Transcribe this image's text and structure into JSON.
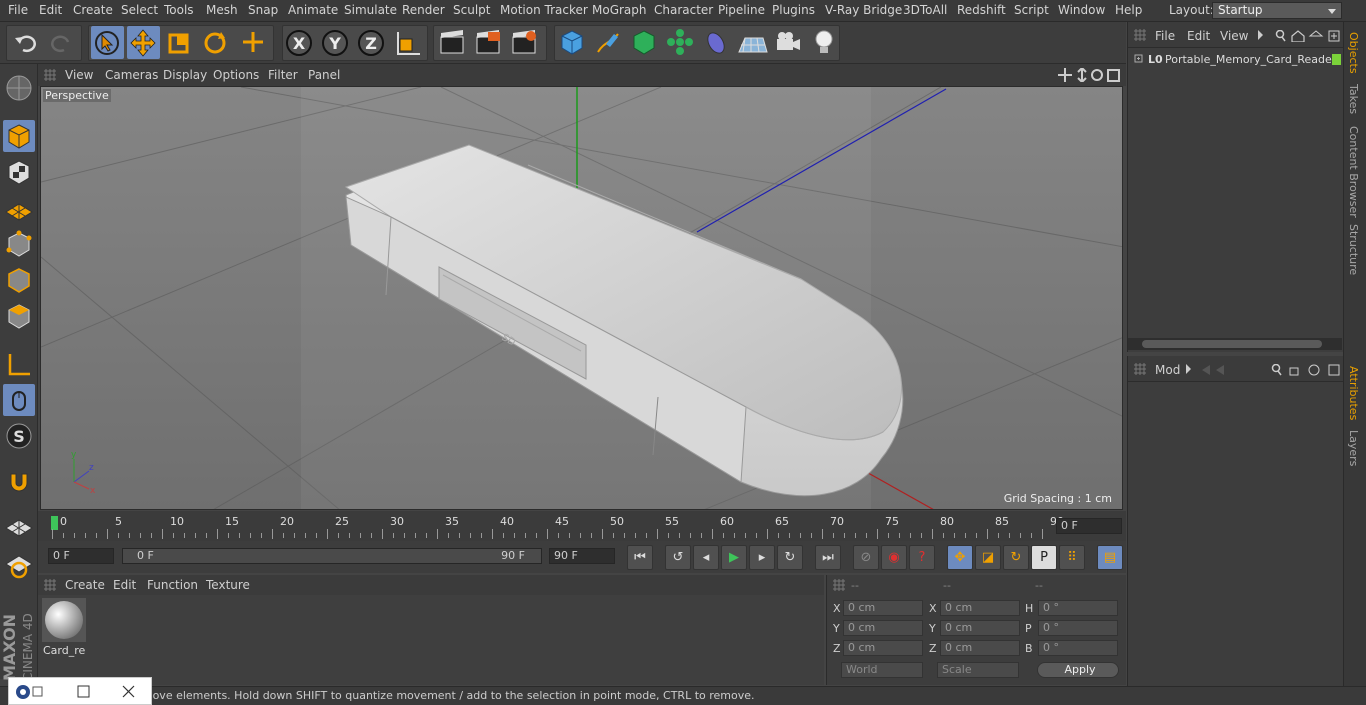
{
  "menubar": {
    "items": [
      "File",
      "Edit",
      "Create",
      "Select",
      "Tools",
      "Mesh",
      "Snap",
      "Animate",
      "Simulate",
      "Render",
      "Sculpt",
      "Motion Tracker",
      "MoGraph",
      "Character",
      "Pipeline",
      "Plugins",
      "V-Ray Bridge",
      "3DToAll",
      "Redshift",
      "Script",
      "Window",
      "Help"
    ],
    "layout_label": "Layout:",
    "layout_value": "Startup"
  },
  "viewport": {
    "menu": [
      "View",
      "Cameras",
      "Display",
      "Options",
      "Filter",
      "Panel"
    ],
    "camera_label": "Perspective",
    "grid_spacing": "Grid Spacing : 1 cm",
    "axis_x": "x",
    "axis_y": "y",
    "axis_z": "z"
  },
  "timeline": {
    "ticks": [
      "0",
      "5",
      "10",
      "15",
      "20",
      "25",
      "30",
      "35",
      "40",
      "45",
      "50",
      "55",
      "60",
      "65",
      "70",
      "75",
      "80",
      "85",
      "90"
    ],
    "current_frame": "0 F"
  },
  "transport": {
    "start_field": "0 F",
    "range_start": "0 F",
    "range_end": "90 F",
    "end_field": "90 F"
  },
  "materials": {
    "menu": [
      "Create",
      "Edit",
      "Function",
      "Texture"
    ],
    "items": [
      {
        "name": "Card_re"
      }
    ]
  },
  "coords": {
    "headers": [
      "--",
      "--",
      "--"
    ],
    "rows": [
      {
        "l1": "X",
        "v1": "0 cm",
        "l2": "X",
        "v2": "0 cm",
        "l3": "H",
        "v3": "0 °"
      },
      {
        "l1": "Y",
        "v1": "0 cm",
        "l2": "Y",
        "v2": "0 cm",
        "l3": "P",
        "v3": "0 °"
      },
      {
        "l1": "Z",
        "v1": "0 cm",
        "l2": "Z",
        "v2": "0 cm",
        "l3": "B",
        "v3": "0 °"
      }
    ],
    "mode": "World",
    "scale_mode": "Scale",
    "apply": "Apply"
  },
  "objects": {
    "menu": [
      "File",
      "Edit",
      "View"
    ],
    "tree": [
      {
        "name": "Portable_Memory_Card_Reader"
      }
    ]
  },
  "attributes": {
    "menu_label": "Mod"
  },
  "right_tabs": [
    "Objects",
    "Takes",
    "Content Browser",
    "Structure",
    "Attributes",
    "Layers"
  ],
  "status": "Move: Click and drag to move elements. Hold down SHIFT to quantize movement / add to the selection in point mode, CTRL to remove.",
  "brand": {
    "line1": "MAXON",
    "line2": "CINEMA 4D"
  },
  "colors": {
    "accent": "#6d8bbf",
    "active_tab": "#e8a000",
    "green_object": "#7bd23a"
  }
}
